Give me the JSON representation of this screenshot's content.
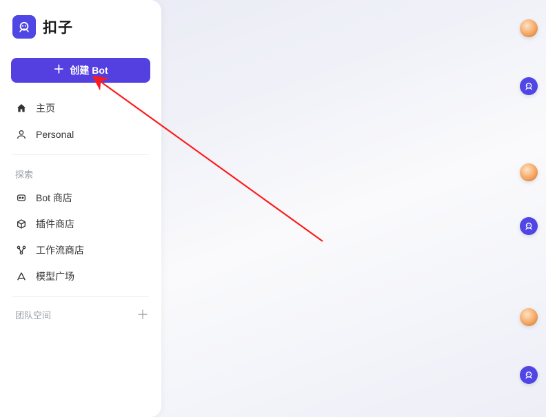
{
  "brand": {
    "title": "扣子"
  },
  "create_button": {
    "label": "创建 Bot"
  },
  "nav": {
    "home": "主页",
    "personal": "Personal"
  },
  "explore": {
    "title": "探索",
    "bot_store": "Bot 商店",
    "plugin_store": "插件商店",
    "workflow_store": "工作流商店",
    "model_square": "模型广场"
  },
  "team": {
    "title": "团队空间"
  }
}
